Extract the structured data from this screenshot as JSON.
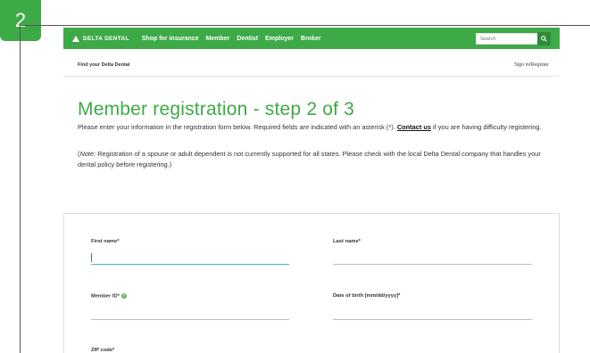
{
  "step_badge": "2",
  "header": {
    "logo_text": "DELTA DENTAL",
    "nav": [
      "Shop for insurance",
      "Member",
      "Dentist",
      "Employer",
      "Broker"
    ],
    "search_placeholder": "Search"
  },
  "subnav": {
    "find": "Find your Delta Dental",
    "sign_in": "Sign in/Register"
  },
  "page": {
    "title": "Member registration - step 2 of 3",
    "intro_before": "Please enter your information in the registration form below. Required fields are indicated with an asterisk (*). ",
    "contact_link": "Contact us",
    "intro_after": " if you are having difficulty registering.",
    "note_label": "Note:",
    "note_text": " Registration of a spouse or adult dependent is not currently supported for all states. Please check with the local Delta Dental company that handles your dental policy before registering.)"
  },
  "form": {
    "first_name_label": "First name*",
    "last_name_label": "Last name*",
    "member_id_label": "Member ID*",
    "dob_label": "Date of birth  [mm/dd/yyyy]*",
    "zip_label": "ZIP code*"
  },
  "colors": {
    "brand_green": "#3daa47",
    "active_underline": "#4cb6b0"
  }
}
